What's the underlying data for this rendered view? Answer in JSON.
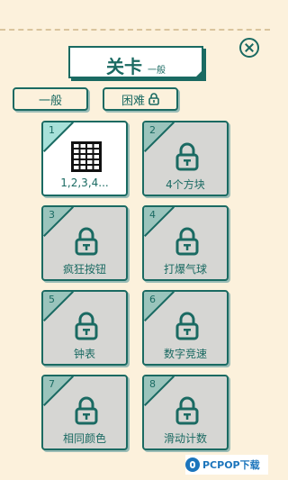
{
  "header": {
    "title": "关卡",
    "subtitle": "一般"
  },
  "modes": {
    "normal_label": "一般",
    "hard_label": "困难"
  },
  "levels": [
    {
      "num": "1",
      "label": "1,2,3,4...",
      "locked": false
    },
    {
      "num": "2",
      "label": "4个方块",
      "locked": true
    },
    {
      "num": "3",
      "label": "疯狂按钮",
      "locked": true
    },
    {
      "num": "4",
      "label": "打爆气球",
      "locked": true
    },
    {
      "num": "5",
      "label": "钟表",
      "locked": true
    },
    {
      "num": "6",
      "label": "数字竞速",
      "locked": true
    },
    {
      "num": "7",
      "label": "相同颜色",
      "locked": true
    },
    {
      "num": "8",
      "label": "滑动计数",
      "locked": true
    }
  ],
  "watermark": {
    "text": "PCPOP下载"
  },
  "colors": {
    "background": "#fcf1dc",
    "accent": "#1a6a62",
    "tile_locked": "#d6d6d3",
    "corner_locked": "#9ac4bc",
    "corner_unlocked": "#a7e1d9"
  }
}
